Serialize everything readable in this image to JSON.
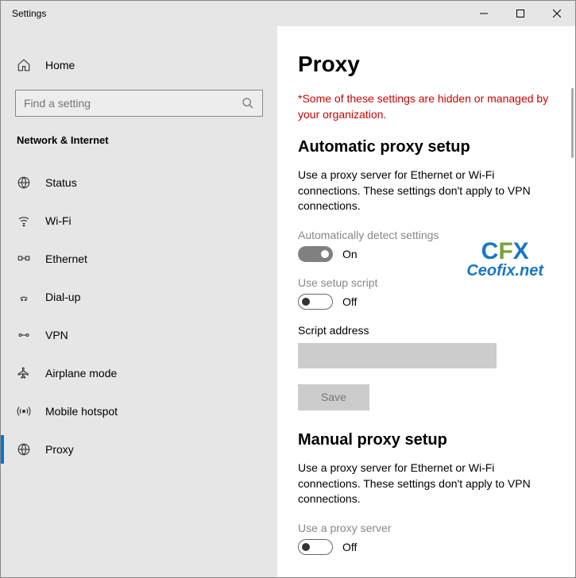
{
  "window": {
    "title": "Settings"
  },
  "sidebar": {
    "home": "Home",
    "search_placeholder": "Find a setting",
    "section": "Network & Internet",
    "items": [
      {
        "label": "Status"
      },
      {
        "label": "Wi-Fi"
      },
      {
        "label": "Ethernet"
      },
      {
        "label": "Dial-up"
      },
      {
        "label": "VPN"
      },
      {
        "label": "Airplane mode"
      },
      {
        "label": "Mobile hotspot"
      },
      {
        "label": "Proxy"
      }
    ]
  },
  "content": {
    "title": "Proxy",
    "warning": "*Some of these settings are hidden or managed by your organization.",
    "auto_heading": "Automatic proxy setup",
    "auto_desc": "Use a proxy server for Ethernet or Wi-Fi connections. These settings don't apply to VPN connections.",
    "auto_detect_label": "Automatically detect settings",
    "auto_detect_state": "On",
    "setup_script_label": "Use setup script",
    "setup_script_state": "Off",
    "script_address_label": "Script address",
    "script_address_value": "",
    "save_label": "Save",
    "manual_heading": "Manual proxy setup",
    "manual_desc": "Use a proxy server for Ethernet or Wi-Fi connections. These settings don't apply to VPN connections.",
    "use_proxy_label": "Use a proxy server",
    "use_proxy_state": "Off"
  },
  "watermark": {
    "line1a": "C",
    "line1b": "F",
    "line1c": "X",
    "line2": "Ceofix.net"
  }
}
